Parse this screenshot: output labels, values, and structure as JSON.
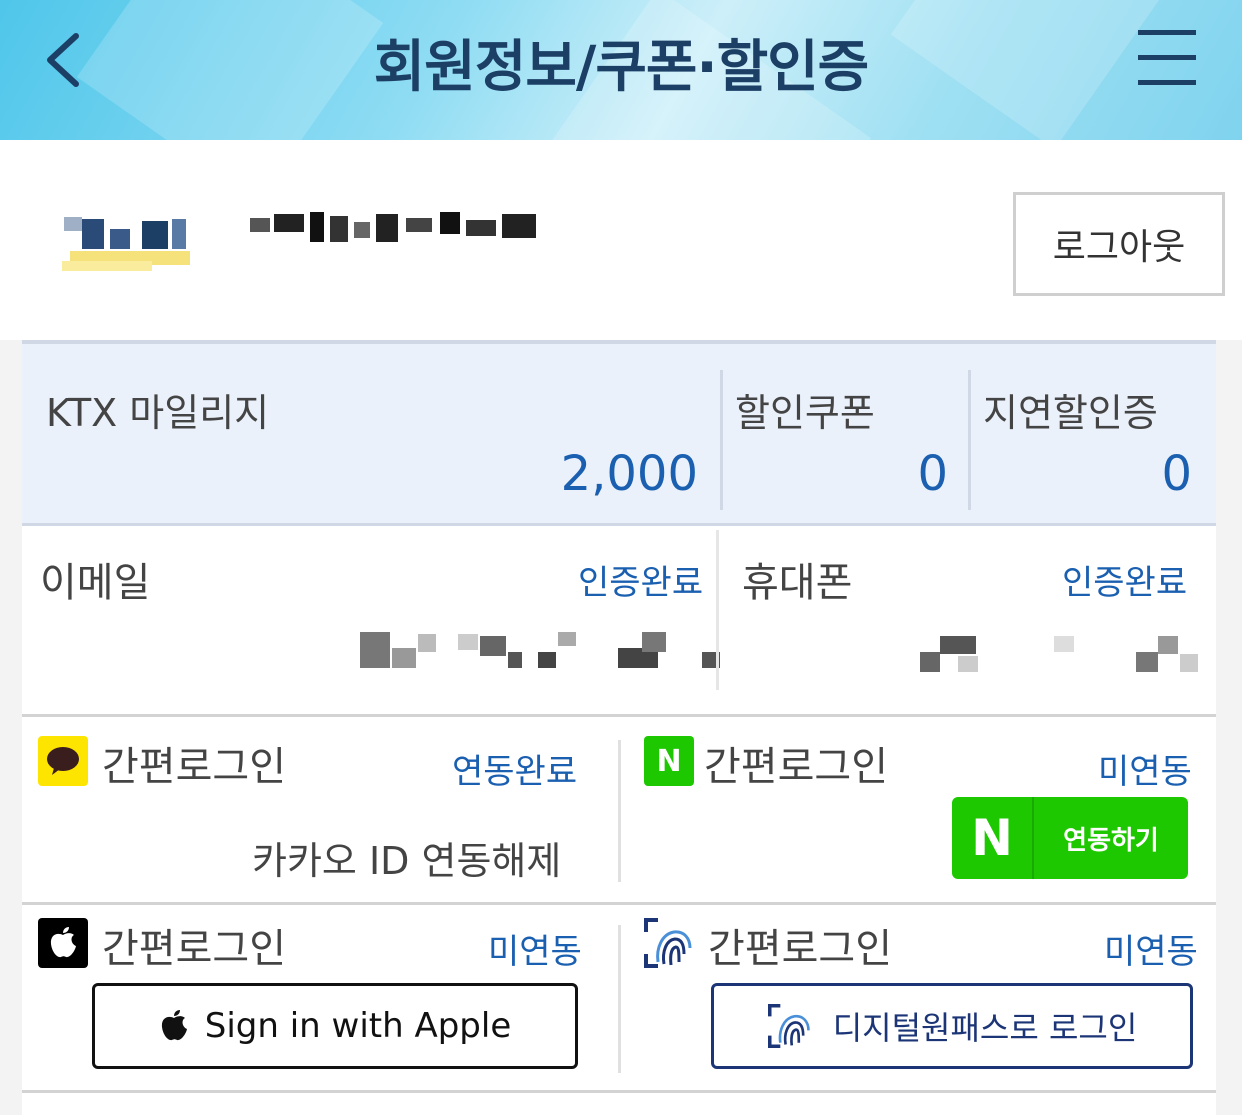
{
  "header": {
    "title": "회원정보/쿠폰·할인증",
    "back_icon": "chevron-left-icon",
    "menu_icon": "hamburger-menu-icon"
  },
  "user": {
    "logout_label": "로그아웃"
  },
  "stats": {
    "mileage": {
      "label": "KTX 마일리지",
      "value": "2,000"
    },
    "coupon": {
      "label": "할인쿠폰",
      "value": "0"
    },
    "delay": {
      "label": "지연할인증",
      "value": "0"
    }
  },
  "verification": {
    "email": {
      "label": "이메일",
      "status": "인증완료"
    },
    "phone": {
      "label": "휴대폰",
      "status": "인증완료"
    }
  },
  "easy_login": {
    "kakao": {
      "label": "간편로그인",
      "status": "연동완료",
      "action": "카카오 ID 연동해제",
      "icon": "kakao-talk-icon"
    },
    "naver": {
      "label": "간편로그인",
      "status": "미연동",
      "button_label": "연동하기",
      "button_logo": "N",
      "icon": "naver-icon"
    },
    "apple": {
      "label": "간편로그인",
      "status": "미연동",
      "button_label": "Sign in with Apple",
      "icon": "apple-icon"
    },
    "digital": {
      "label": "간편로그인",
      "status": "미연동",
      "button_label": "디지털원패스로 로그인",
      "icon": "digital-onepass-icon"
    }
  },
  "colors": {
    "accent_blue": "#1a5fb0",
    "title_navy": "#1c3f66",
    "naver_green": "#1ec800",
    "kakao_yellow": "#fee500",
    "onepass_navy": "#1c3576"
  }
}
